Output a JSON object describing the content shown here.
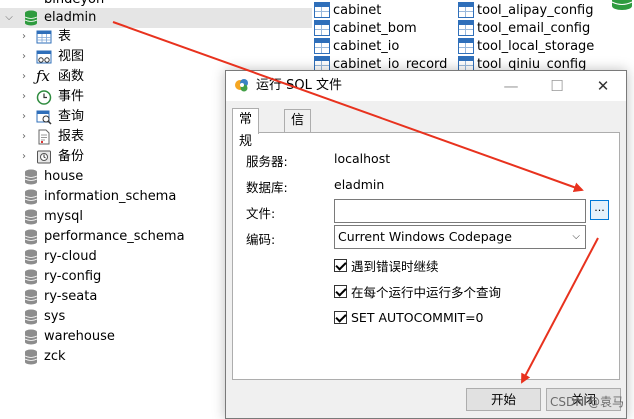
{
  "tree": {
    "partial_top": "bindeyon",
    "selected_db": "eladmin",
    "children": [
      {
        "label": "表",
        "icon": "table-icon"
      },
      {
        "label": "视图",
        "icon": "view-icon"
      },
      {
        "label": "函数",
        "icon": "function-icon"
      },
      {
        "label": "事件",
        "icon": "event-icon"
      },
      {
        "label": "查询",
        "icon": "query-icon"
      },
      {
        "label": "报表",
        "icon": "report-icon"
      },
      {
        "label": "备份",
        "icon": "backup-icon"
      }
    ],
    "databases": [
      "house",
      "information_schema",
      "mysql",
      "performance_schema",
      "ry-cloud",
      "ry-config",
      "ry-seata",
      "sys",
      "warehouse",
      "zck"
    ]
  },
  "tables": {
    "col1": [
      "cabinet",
      "cabinet_bom",
      "cabinet_io",
      "cabinet_io_record"
    ],
    "col2": [
      "tool_alipay_config",
      "tool_email_config",
      "tool_local_storage",
      "tool_qiniu_config"
    ]
  },
  "dialog": {
    "title": "运行 SQL 文件",
    "minimize": "—",
    "maximize": "☐",
    "close": "✕",
    "tabs": [
      "常规",
      "信息日志"
    ],
    "server_label": "服务器:",
    "server_value": "localhost",
    "db_label": "数据库:",
    "db_value": "eladmin",
    "file_label": "文件:",
    "file_value": "",
    "browse_label": "...",
    "encoding_label": "编码:",
    "encoding_value": "Current Windows Codepage",
    "checkboxes": [
      {
        "label": "遇到错误时继续",
        "checked": true
      },
      {
        "label": "在每个运行中运行多个查询",
        "checked": true
      },
      {
        "label": "SET AUTOCOMMIT=0",
        "checked": true
      }
    ],
    "start_button": "开始",
    "close_button": "关闭"
  },
  "watermark": "CSDN @袁马",
  "colors": {
    "arrow": "#e8321e",
    "accent": "#0078d7",
    "selected_row": "#e5e5e5"
  }
}
